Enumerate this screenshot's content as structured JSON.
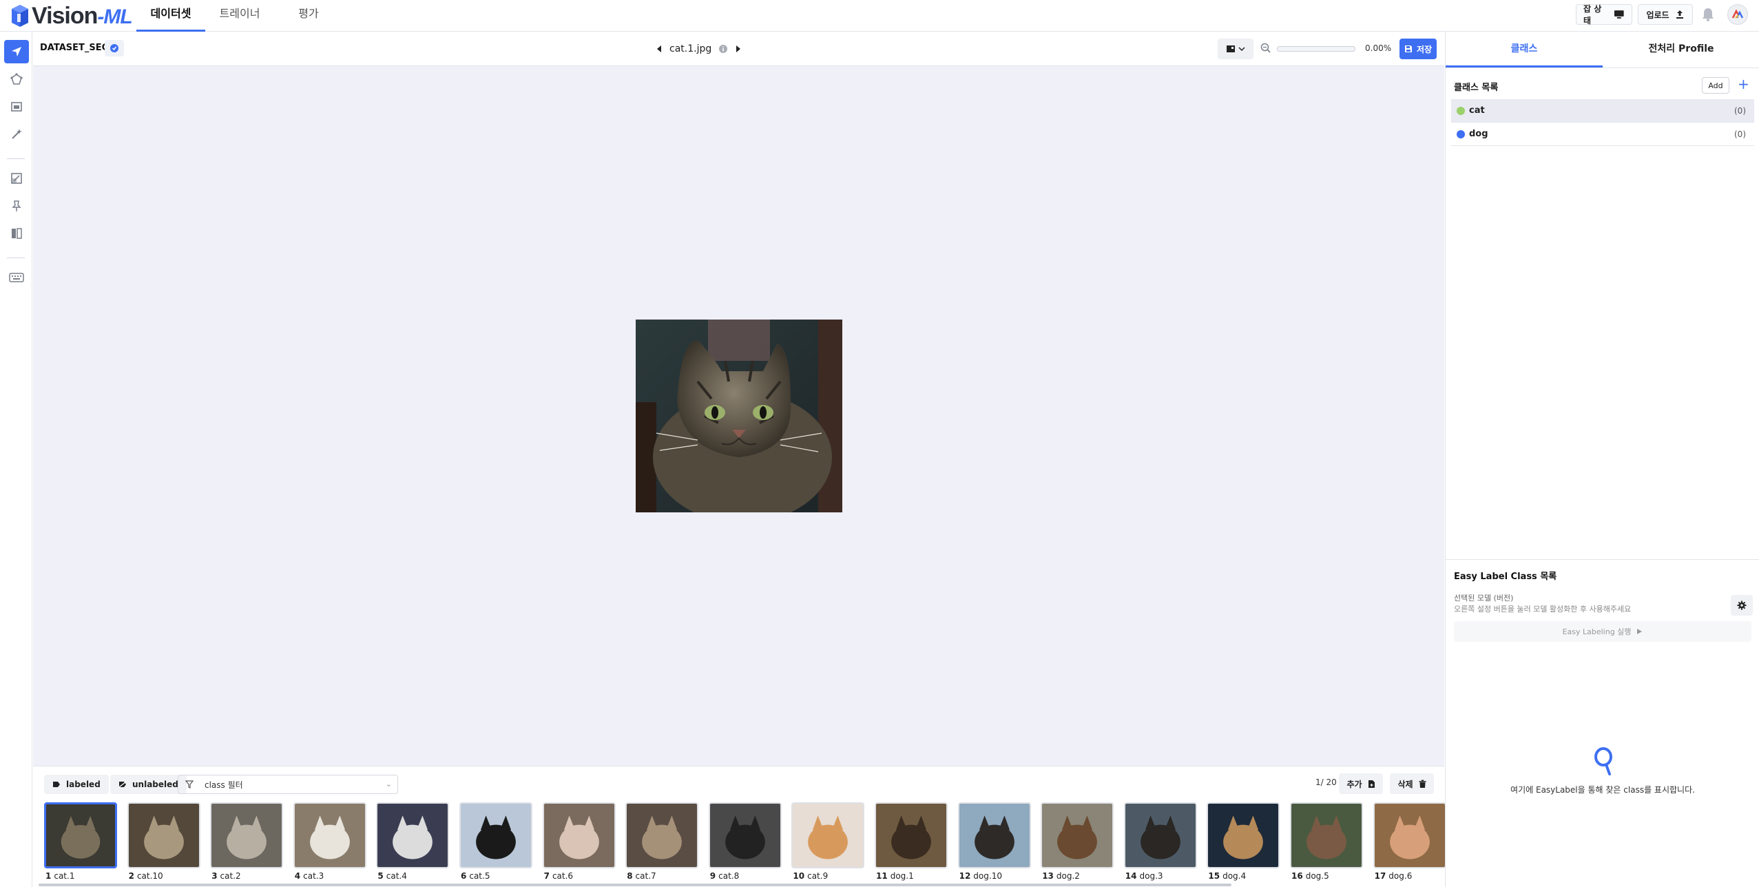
{
  "header": {
    "logo_text": "Vision",
    "logo_suffix": "-ML",
    "nav": [
      {
        "label": "데이터셋",
        "active": true
      },
      {
        "label": "트레이너",
        "active": false
      },
      {
        "label": "평가",
        "active": false
      }
    ],
    "job_status_label": "잡 상태",
    "upload_label": "업로드"
  },
  "tools": [
    "navigate-icon",
    "polygon-icon",
    "bbox-icon",
    "magic-wand-icon",
    "crop-icon",
    "pin-icon",
    "compare-icon",
    "keyboard-icon"
  ],
  "workspace": {
    "dataset_name": "DATASET_SEG",
    "file_name": "cat.1.jpg",
    "zoom_value": "0.00%",
    "zoom_progress": 0,
    "save_label": "저장"
  },
  "filmstrip": {
    "labeled_label": "labeled",
    "unlabeled_label": "unlabeled",
    "filter_placeholder": "class 필터",
    "counter": "1/ 20",
    "add_label": "추가",
    "delete_label": "삭제",
    "items": [
      {
        "num": "1",
        "name": "cat.1"
      },
      {
        "num": "2",
        "name": "cat.10"
      },
      {
        "num": "3",
        "name": "cat.2"
      },
      {
        "num": "4",
        "name": "cat.3"
      },
      {
        "num": "5",
        "name": "cat.4"
      },
      {
        "num": "6",
        "name": "cat.5"
      },
      {
        "num": "7",
        "name": "cat.6"
      },
      {
        "num": "8",
        "name": "cat.7"
      },
      {
        "num": "9",
        "name": "cat.8"
      },
      {
        "num": "10",
        "name": "cat.9"
      },
      {
        "num": "11",
        "name": "dog.1"
      },
      {
        "num": "12",
        "name": "dog.10"
      },
      {
        "num": "13",
        "name": "dog.2"
      },
      {
        "num": "14",
        "name": "dog.3"
      },
      {
        "num": "15",
        "name": "dog.4"
      },
      {
        "num": "16",
        "name": "dog.5"
      },
      {
        "num": "17",
        "name": "dog.6"
      }
    ]
  },
  "right_panel": {
    "tabs": [
      {
        "label": "클래스",
        "active": true
      },
      {
        "label": "전처리 Profile",
        "active": false
      }
    ],
    "class_list_title": "클래스 목록",
    "add_label": "Add",
    "classes": [
      {
        "name": "cat",
        "count": "(0)",
        "color": "#9bd16a"
      },
      {
        "name": "dog",
        "count": "(0)",
        "color": "#3e6ff2"
      }
    ],
    "easy_title": "Easy Label Class 목록",
    "model_label": "선택된 모델 (버전)",
    "model_hint": "오른쪽 설정 버튼을 눌러 모델 활성화한 후 사용해주세요",
    "easy_run_label": "Easy Labeling 실행",
    "empty_message": "여기에 EasyLabel을 통해 찾은 class를 표시합니다."
  },
  "colors": {
    "accent": "#3e6ff2",
    "canvas_bg": "#f0f0f9"
  }
}
